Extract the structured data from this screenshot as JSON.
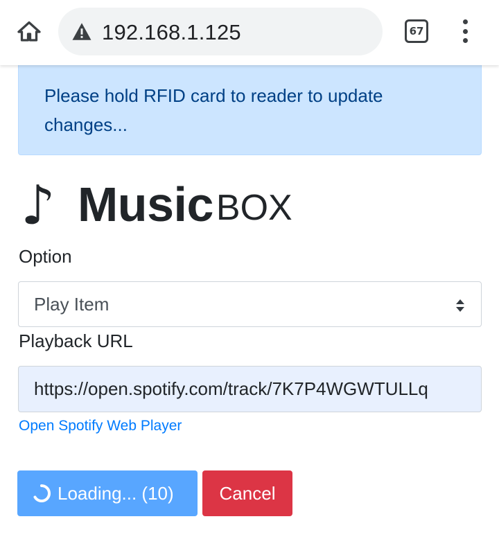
{
  "browser": {
    "url": "192.168.1.125",
    "tab_count": "67",
    "icons": [
      "home-icon",
      "warning-icon",
      "tabs-icon",
      "more-vert-icon"
    ]
  },
  "alert": {
    "message": "Please hold RFID card to reader to update changes..."
  },
  "brand": {
    "note_icon": "♪",
    "name_bold": "Music",
    "name_light": "BOX"
  },
  "form": {
    "option_label": "Option",
    "option_value": "Play Item",
    "url_label": "Playback URL",
    "url_value": "https://open.spotify.com/track/7K7P4WGWTULLq",
    "spotify_link": "Open Spotify Web Player"
  },
  "buttons": {
    "loading_label": "Loading... (10)",
    "cancel_label": "Cancel"
  },
  "colors": {
    "alert_bg": "#cce5ff",
    "alert_text": "#004085",
    "primary": "#58a6ff",
    "danger": "#dc3545",
    "link": "#007bff",
    "autofill_bg": "#e8f0fe"
  }
}
